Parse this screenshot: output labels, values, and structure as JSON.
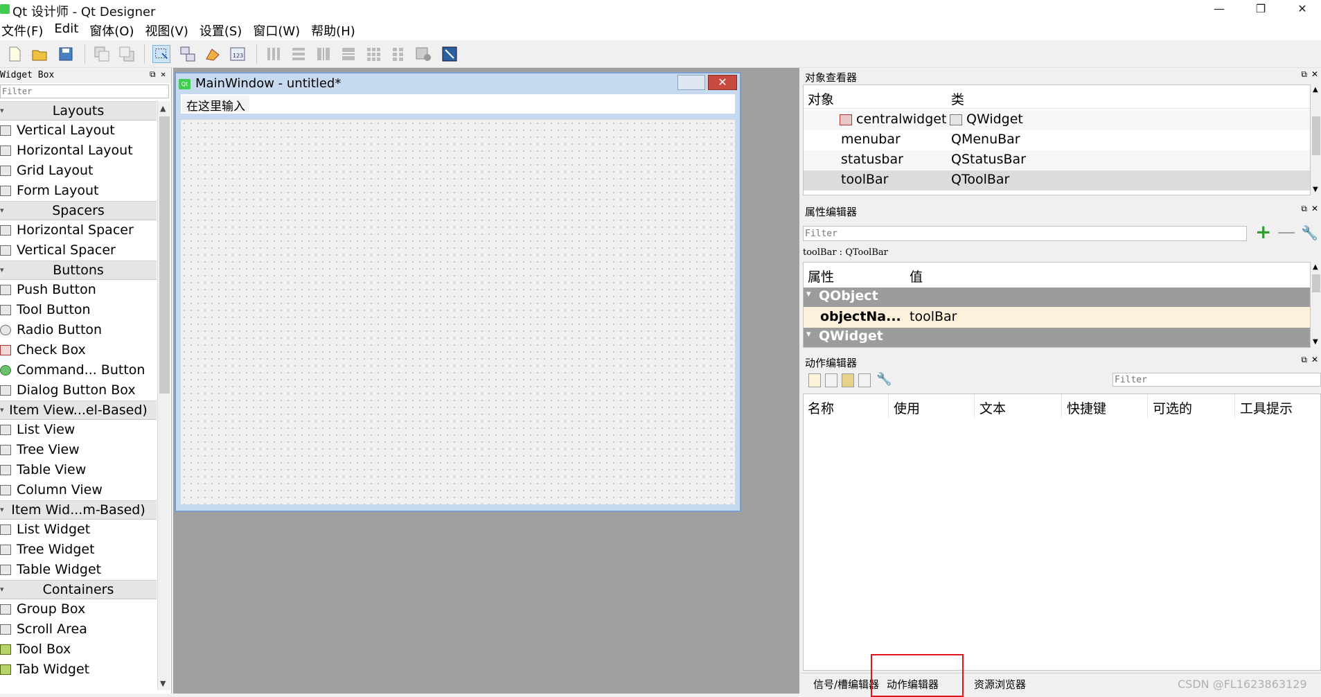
{
  "window": {
    "title": "Qt 设计师 - Qt Designer",
    "min_glyph": "—",
    "max_glyph": "❐",
    "close_glyph": "✕"
  },
  "menubar": [
    "文件(F)",
    "Edit",
    "窗体(O)",
    "视图(V)",
    "设置(S)",
    "窗口(W)",
    "帮助(H)"
  ],
  "widget_box": {
    "title": "Widget Box",
    "filter_placeholder": "Filter",
    "categories": [
      {
        "label": "Layouts",
        "items": [
          "Vertical Layout",
          "Horizontal Layout",
          "Grid Layout",
          "Form Layout"
        ]
      },
      {
        "label": "Spacers",
        "items": [
          "Horizontal Spacer",
          "Vertical Spacer"
        ]
      },
      {
        "label": "Buttons",
        "items": [
          "Push Button",
          "Tool Button",
          "Radio Button",
          "Check Box",
          "Command... Button",
          "Dialog Button Box"
        ]
      },
      {
        "label": "Item View...el-Based)",
        "items": [
          "List View",
          "Tree View",
          "Table View",
          "Column View"
        ]
      },
      {
        "label": "Item Wid...m-Based)",
        "items": [
          "List Widget",
          "Tree Widget",
          "Table Widget"
        ]
      },
      {
        "label": "Containers",
        "items": [
          "Group Box",
          "Scroll Area",
          "Tool Box",
          "Tab Widget"
        ]
      }
    ]
  },
  "form": {
    "title": "MainWindow - untitled*",
    "icon_text": "Qt",
    "menu_placeholder": "在这里输入"
  },
  "object_inspector": {
    "title": "对象查看器",
    "col_object": "对象",
    "col_class": "类",
    "rows": [
      {
        "object": "centralwidget",
        "class": "QWidget"
      },
      {
        "object": "menubar",
        "class": "QMenuBar"
      },
      {
        "object": "statusbar",
        "class": "QStatusBar"
      },
      {
        "object": "toolBar",
        "class": "QToolBar"
      }
    ]
  },
  "property_editor": {
    "title": "属性编辑器",
    "filter_placeholder": "Filter",
    "object_line": "toolBar : QToolBar",
    "col_property": "属性",
    "col_value": "值",
    "group_qobject": "QObject",
    "row_name": "objectNa...",
    "row_value": "toolBar",
    "group_qwidget": "QWidget"
  },
  "action_editor": {
    "title": "动作编辑器",
    "filter_placeholder": "Filter",
    "columns": [
      "名称",
      "使用",
      "文本",
      "快捷键",
      "可选的",
      "工具提示"
    ]
  },
  "bottom_tabs": [
    "信号/槽编辑器",
    "动作编辑器",
    "资源浏览器"
  ],
  "watermark": "CSDN @FL1623863129",
  "colors": {
    "accent_select": "#cde3f7",
    "highlight_box": "#e0151b",
    "property_group": "#9c9c9c",
    "property_row": "#fdf1dc"
  }
}
